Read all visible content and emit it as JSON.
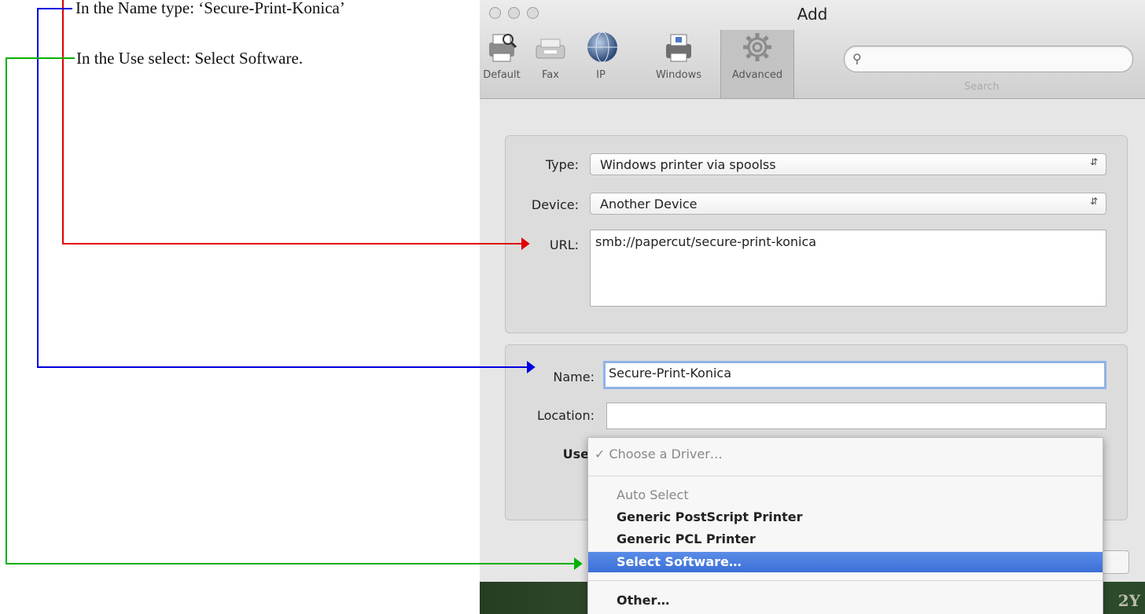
{
  "annotations": {
    "name_note": "In the Name type: ‘Secure-Print-Konica’",
    "use_note": "In the Use select: Select Software."
  },
  "window": {
    "title": "Add",
    "toolbar": [
      {
        "label": "Default",
        "icon": "printer-icon"
      },
      {
        "label": "Fax",
        "icon": "fax-icon"
      },
      {
        "label": "IP",
        "icon": "globe-icon"
      },
      {
        "label": "Windows",
        "icon": "windows-printer-icon"
      },
      {
        "label": "Advanced",
        "icon": "gear-icon",
        "selected": true
      }
    ],
    "search": {
      "placeholder": "",
      "label": "Search"
    }
  },
  "connection": {
    "type_label": "Type:",
    "type_value": "Windows printer via spoolss",
    "device_label": "Device:",
    "device_value": "Another Device",
    "url_label": "URL:",
    "url_value": "smb://papercut/secure-print-konica"
  },
  "details": {
    "name_label": "Name:",
    "name_value": "Secure-Print-Konica",
    "location_label": "Location:",
    "location_value": "",
    "use_label": "Use"
  },
  "use_menu": {
    "checked_item": "✓ Choose a Driver…",
    "items": [
      "Auto Select",
      "Generic PostScript Printer",
      "Generic PCL Printer",
      "Select Software…",
      "Other…"
    ],
    "highlighted": "Select Software…"
  },
  "background_text": "2Y",
  "colors": {
    "connector_red": "#e00000",
    "connector_blue": "#0000e0",
    "connector_green": "#00b000",
    "menu_highlight": "#3b6fd6"
  }
}
